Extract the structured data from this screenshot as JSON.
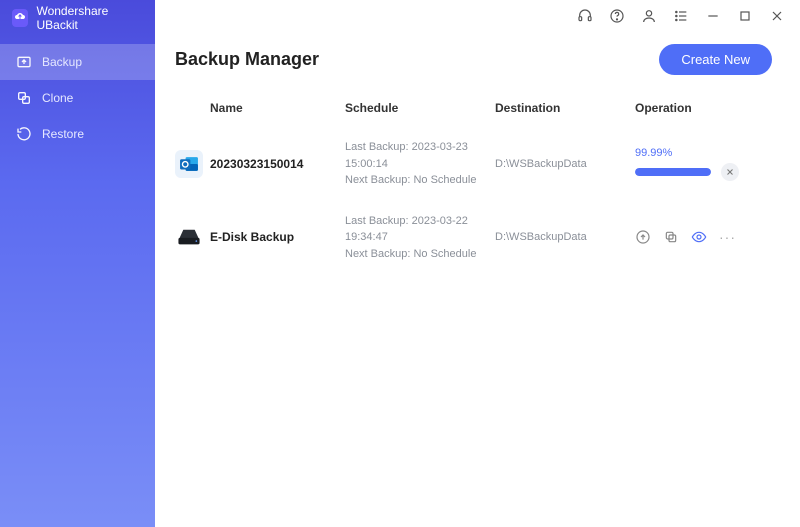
{
  "app": {
    "title": "Wondershare UBackit"
  },
  "sidebar": {
    "items": [
      {
        "label": "Backup"
      },
      {
        "label": "Clone"
      },
      {
        "label": "Restore"
      }
    ]
  },
  "header": {
    "title": "Backup Manager",
    "create_label": "Create New"
  },
  "columns": {
    "name": "Name",
    "schedule": "Schedule",
    "destination": "Destination",
    "operation": "Operation"
  },
  "rows": [
    {
      "icon": "outlook",
      "name": "20230323150014",
      "last_backup": "Last Backup: 2023-03-23 15:00:14",
      "next_backup": "Next Backup: No Schedule",
      "destination": "D:\\WSBackupData",
      "operation": {
        "kind": "progress",
        "percent_label": "99.99%",
        "percent": 99.99
      }
    },
    {
      "icon": "disk",
      "name": "E-Disk Backup",
      "last_backup": "Last Backup: 2023-03-22 19:34:47",
      "next_backup": "Next Backup: No Schedule",
      "destination": "D:\\WSBackupData",
      "operation": {
        "kind": "actions"
      }
    }
  ]
}
